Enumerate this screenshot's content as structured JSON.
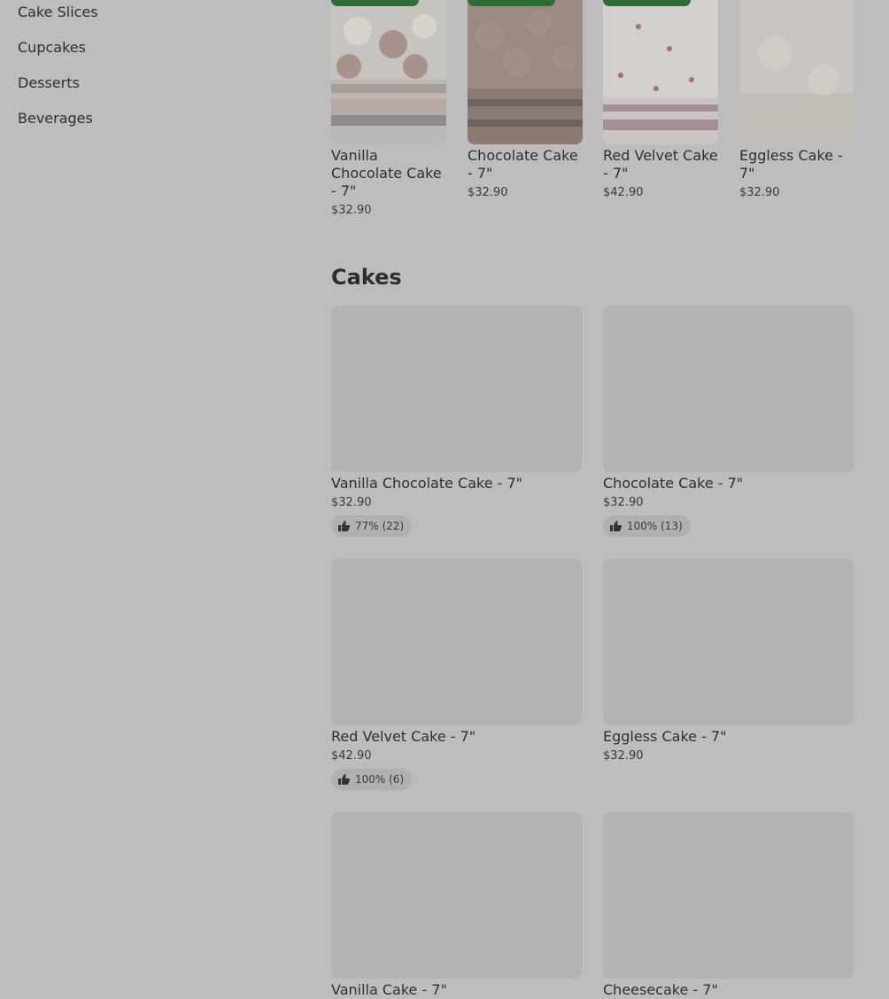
{
  "sidebar": {
    "items": [
      "Cake Slices",
      "Cupcakes",
      "Desserts",
      "Beverages"
    ]
  },
  "featured": [
    {
      "name": "Vanilla Chocolate Cake - 7\"",
      "price": "$32.90",
      "image": "vanilla-chocolate-cake-photo"
    },
    {
      "name": "Chocolate Cake - 7\"",
      "price": "$32.90",
      "image": "chocolate-cake-photo"
    },
    {
      "name": "Red Velvet Cake - 7\"",
      "price": "$42.90",
      "image": "red-velvet-cake-photo"
    },
    {
      "name": "Eggless Cake - 7\"",
      "price": "$32.90",
      "image": "eggless-cake-photo"
    }
  ],
  "cakes_section": {
    "title": "Cakes",
    "items": [
      {
        "name": "Vanilla Chocolate Cake - 7\"",
        "price": "$32.90",
        "rating": "77% (22)"
      },
      {
        "name": "Chocolate Cake - 7\"",
        "price": "$32.90",
        "rating": "100% (13)"
      },
      {
        "name": "Red Velvet Cake - 7\"",
        "price": "$42.90",
        "rating": "100% (6)"
      },
      {
        "name": "Eggless Cake - 7\"",
        "price": "$32.90"
      },
      {
        "name": "Vanilla Cake - 7\""
      },
      {
        "name": "Cheesecake - 7\""
      }
    ]
  },
  "colors": {
    "overlay_background": "#bdbdbd",
    "tag_green": "#2f6b35",
    "placeholder": "#b3b3b3"
  },
  "icons": {
    "rating": "thumbs-up-icon"
  }
}
